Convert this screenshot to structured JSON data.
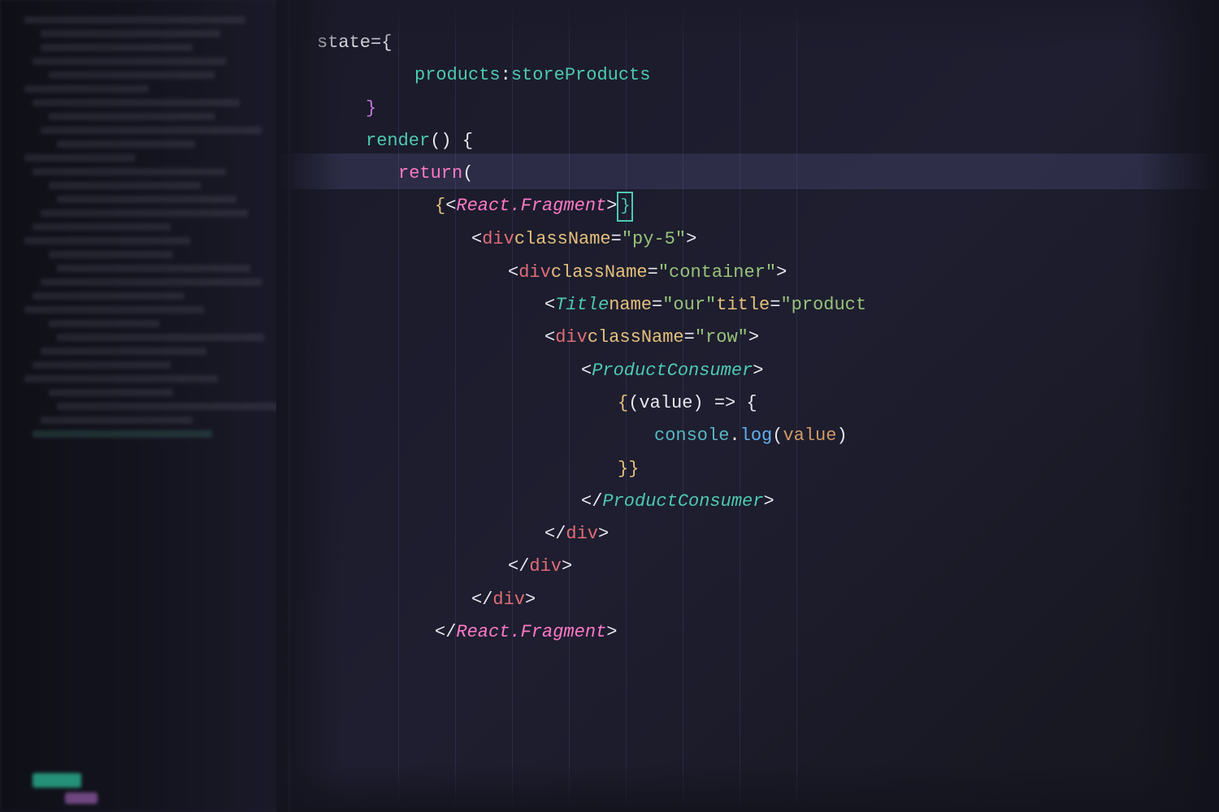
{
  "editor": {
    "background": "#1e1e2e",
    "lines": [
      {
        "indent": 0,
        "tokens": [
          {
            "text": "state={",
            "color": "white"
          }
        ]
      },
      {
        "indent": 4,
        "tokens": [
          {
            "text": "products",
            "color": "cyan"
          },
          {
            "text": ": ",
            "color": "white"
          },
          {
            "text": "storeProducts",
            "color": "cyan"
          }
        ]
      },
      {
        "indent": 2,
        "tokens": [
          {
            "text": "}",
            "color": "magenta"
          }
        ]
      },
      {
        "indent": 2,
        "tokens": [
          {
            "text": "render",
            "color": "cyan"
          },
          {
            "text": "() {",
            "color": "white"
          }
        ]
      },
      {
        "indent": 4,
        "tokens": [
          {
            "text": "return",
            "color": "pink"
          },
          {
            "text": " (",
            "color": "white"
          }
        ]
      },
      {
        "indent": 6,
        "tokens": [
          {
            "text": "{",
            "color": "yellow"
          },
          {
            "text": "<",
            "color": "white"
          },
          {
            "text": "React.Fragment",
            "color": "pink2-italic"
          },
          {
            "text": ">",
            "color": "white"
          },
          {
            "text": "}",
            "color": "yellow"
          },
          {
            "text": "cursor",
            "color": "cursor"
          }
        ]
      },
      {
        "indent": 8,
        "tokens": [
          {
            "text": "<",
            "color": "white"
          },
          {
            "text": "div",
            "color": "pink2"
          },
          {
            "text": " className",
            "color": "yellow"
          },
          {
            "text": "=",
            "color": "white"
          },
          {
            "text": "\"py-5\"",
            "color": "green"
          },
          {
            "text": ">",
            "color": "white"
          }
        ]
      },
      {
        "indent": 10,
        "tokens": [
          {
            "text": "<",
            "color": "white"
          },
          {
            "text": "div",
            "color": "pink2"
          },
          {
            "text": " className",
            "color": "yellow"
          },
          {
            "text": "=",
            "color": "white"
          },
          {
            "text": "\"container\"",
            "color": "green"
          },
          {
            "text": ">",
            "color": "white"
          }
        ]
      },
      {
        "indent": 12,
        "tokens": [
          {
            "text": "<",
            "color": "white"
          },
          {
            "text": "Title",
            "color": "cyan-italic"
          },
          {
            "text": " name",
            "color": "yellow"
          },
          {
            "text": "=",
            "color": "white"
          },
          {
            "text": "\"our\"",
            "color": "green"
          },
          {
            "text": " title",
            "color": "yellow"
          },
          {
            "text": "=",
            "color": "white"
          },
          {
            "text": " \"product",
            "color": "green-partial"
          }
        ]
      },
      {
        "indent": 12,
        "tokens": [
          {
            "text": "<",
            "color": "white"
          },
          {
            "text": "div",
            "color": "pink2"
          },
          {
            "text": " className",
            "color": "yellow"
          },
          {
            "text": "=",
            "color": "white"
          },
          {
            "text": "\"row\"",
            "color": "green"
          },
          {
            "text": ">",
            "color": "white"
          }
        ]
      },
      {
        "indent": 14,
        "tokens": [
          {
            "text": "<",
            "color": "white"
          },
          {
            "text": "ProductConsumer",
            "color": "cyan-italic"
          },
          {
            "text": ">",
            "color": "white"
          }
        ]
      },
      {
        "indent": 16,
        "tokens": [
          {
            "text": "{",
            "color": "yellow"
          },
          {
            "text": "(value) => {",
            "color": "white"
          }
        ]
      },
      {
        "indent": 18,
        "tokens": [
          {
            "text": "console",
            "color": "lightblue"
          },
          {
            "text": ".",
            "color": "white"
          },
          {
            "text": "log",
            "color": "blue"
          },
          {
            "text": "(",
            "color": "white"
          },
          {
            "text": "value",
            "color": "orange"
          },
          {
            "text": ")",
            "color": "white"
          }
        ]
      },
      {
        "indent": 16,
        "tokens": [
          {
            "text": "}}",
            "color": "yellow"
          }
        ]
      },
      {
        "indent": 14,
        "tokens": [
          {
            "text": "</",
            "color": "white"
          },
          {
            "text": "ProductConsumer",
            "color": "cyan-italic"
          },
          {
            "text": ">",
            "color": "white"
          }
        ]
      },
      {
        "indent": 12,
        "tokens": [
          {
            "text": "</",
            "color": "white"
          },
          {
            "text": "div",
            "color": "pink2"
          },
          {
            "text": ">",
            "color": "white"
          }
        ]
      },
      {
        "indent": 10,
        "tokens": [
          {
            "text": "</",
            "color": "white"
          },
          {
            "text": "div",
            "color": "pink2"
          },
          {
            "text": ">",
            "color": "white"
          }
        ]
      },
      {
        "indent": 8,
        "tokens": [
          {
            "text": "</",
            "color": "white"
          },
          {
            "text": "div",
            "color": "pink2"
          },
          {
            "text": ">",
            "color": "white"
          }
        ]
      },
      {
        "indent": 6,
        "tokens": [
          {
            "text": "</",
            "color": "white"
          },
          {
            "text": "React.Fragment",
            "color": "pink2-italic"
          },
          {
            "text": ">",
            "color": "white"
          }
        ]
      }
    ]
  }
}
